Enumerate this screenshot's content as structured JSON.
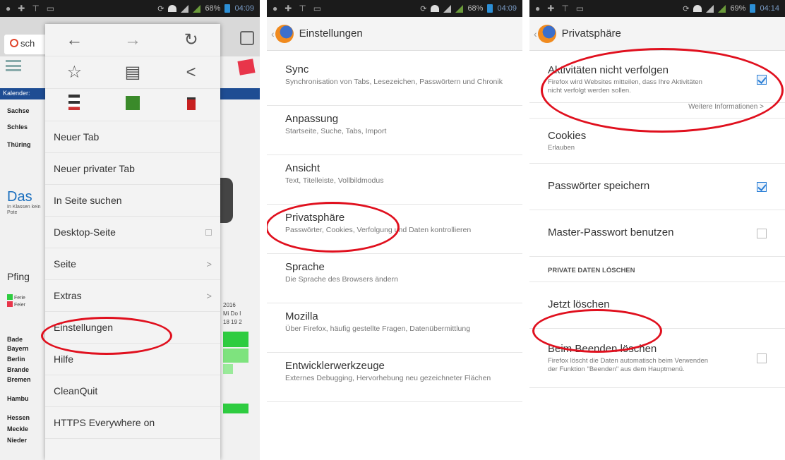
{
  "phone1": {
    "status": {
      "battery": "68%",
      "time": "04:09"
    },
    "url_text": "sch",
    "tab_count": "",
    "page_bg": {
      "blue_bar": "Kalender:",
      "rows": [
        "Sachse",
        "Schles",
        "Thüring"
      ],
      "das_title": "Das",
      "das_sub": "In Klassen kein Pote",
      "pfing": "Pfing",
      "legend": [
        "Ferie",
        "Feier"
      ],
      "right_texts": [
        "2016",
        "Mi Do I",
        "18 19 2"
      ],
      "states": [
        "Bade",
        "Bayern",
        "Berlin",
        "Brande",
        "Bremen",
        "Hambu",
        "Hessen",
        "Meckle",
        "Nieder"
      ]
    },
    "menu": {
      "items": [
        {
          "label": "Neuer Tab"
        },
        {
          "label": "Neuer privater Tab"
        },
        {
          "label": "In Seite suchen"
        },
        {
          "label": "Desktop-Seite"
        },
        {
          "label": "Seite"
        },
        {
          "label": "Extras"
        },
        {
          "label": "Einstellungen"
        },
        {
          "label": "Hilfe"
        },
        {
          "label": "CleanQuit"
        },
        {
          "label": "HTTPS Everywhere on"
        }
      ]
    }
  },
  "phone2": {
    "status": {
      "battery": "68%",
      "time": "04:09"
    },
    "title": "Einstellungen",
    "items": [
      {
        "title": "Sync",
        "sub": "Synchronisation von Tabs, Lesezeichen, Passwörtern und Chronik"
      },
      {
        "title": "Anpassung",
        "sub": "Startseite, Suche, Tabs, Import"
      },
      {
        "title": "Ansicht",
        "sub": "Text, Titelleiste, Vollbildmodus"
      },
      {
        "title": "Privatsphäre",
        "sub": "Passwörter, Cookies, Verfolgung und Daten kontrollieren"
      },
      {
        "title": "Sprache",
        "sub": "Die Sprache des Browsers ändern"
      },
      {
        "title": "Mozilla",
        "sub": "Über Firefox, häufig gestellte Fragen, Datenübermittlung"
      },
      {
        "title": "Entwicklerwerkzeuge",
        "sub": "Externes Debugging, Hervorhebung neu gezeichneter Flächen"
      }
    ]
  },
  "phone3": {
    "status": {
      "battery": "69%",
      "time": "04:14"
    },
    "title": "Privatsphäre",
    "dnt": {
      "title": "Aktivitäten nicht verfolgen",
      "sub": "Firefox wird Websites mitteilen, dass Ihre Aktivitäten nicht verfolgt werden sollen.",
      "checked": true
    },
    "more_info": "Weitere Informationen",
    "cookies": {
      "title": "Cookies",
      "sub": "Erlauben"
    },
    "save_pw": {
      "title": "Passwörter speichern",
      "checked": true
    },
    "master_pw": {
      "title": "Master-Passwort benutzen",
      "checked": false
    },
    "section": "PRIVATE DATEN LÖSCHEN",
    "clear_now": {
      "title": "Jetzt löschen"
    },
    "clear_exit": {
      "title": "Beim Beenden löschen",
      "sub": "Firefox löscht die Daten automatisch beim Verwenden der Funktion \"Beenden\" aus dem Hauptmenü.",
      "checked": false
    }
  },
  "colors": {
    "highlight": "#e0101e",
    "firefox_blue": "#2b7fd6"
  }
}
